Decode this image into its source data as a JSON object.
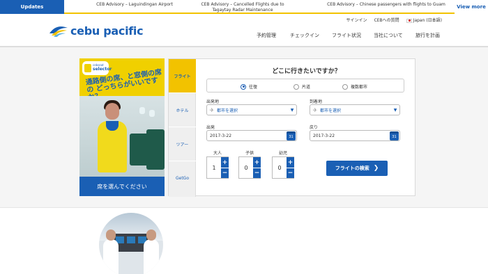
{
  "updates": {
    "tag": "Updates",
    "items": [
      "CEB Advisory – Laguindingan Airport",
      "CEB Advisory – Cancelled Flights due to Tagaytay Radar Maintenance",
      "CEB Advisory – Chinese passengers with flights to Guam"
    ],
    "view_more": "View more"
  },
  "header": {
    "brand": "cebu pacific",
    "top_links": {
      "signin": "サインイン",
      "membership": "CEBへの質問",
      "language": "Japan (日本語)"
    },
    "nav": [
      "予約管理",
      "チェックイン",
      "フライト状況",
      "当社について",
      "旅行を計画"
    ]
  },
  "ad": {
    "badge_small": "cebseat",
    "badge_big": "selector",
    "headline": "通路側の席、と窓側の席の どっちらがいいですか？",
    "cta": "席を選んでください"
  },
  "search": {
    "tabs": [
      "フライト",
      "ホテル",
      "ツアー",
      "GetGo"
    ],
    "title": "どこに行きたいですか？",
    "trip_types": [
      "往復",
      "片道",
      "複数都市"
    ],
    "selected_trip": "往復",
    "origin_label": "出発地",
    "origin_value": "都市を選択",
    "destination_label": "到着地",
    "destination_value": "都市を選択",
    "depart_label": "出発",
    "depart_value": "2017-3-22",
    "return_label": "戻り",
    "return_value": "2017-3-22",
    "calendar_day": "31",
    "adults_label": "大人",
    "adults_value": "1",
    "children_label": "子供",
    "children_value": "0",
    "infants_label": "幼児",
    "infants_value": "0",
    "submit": "フライトの検索"
  },
  "colors": {
    "brand_blue": "#1a5fb4",
    "brand_yellow": "#f2c200"
  }
}
